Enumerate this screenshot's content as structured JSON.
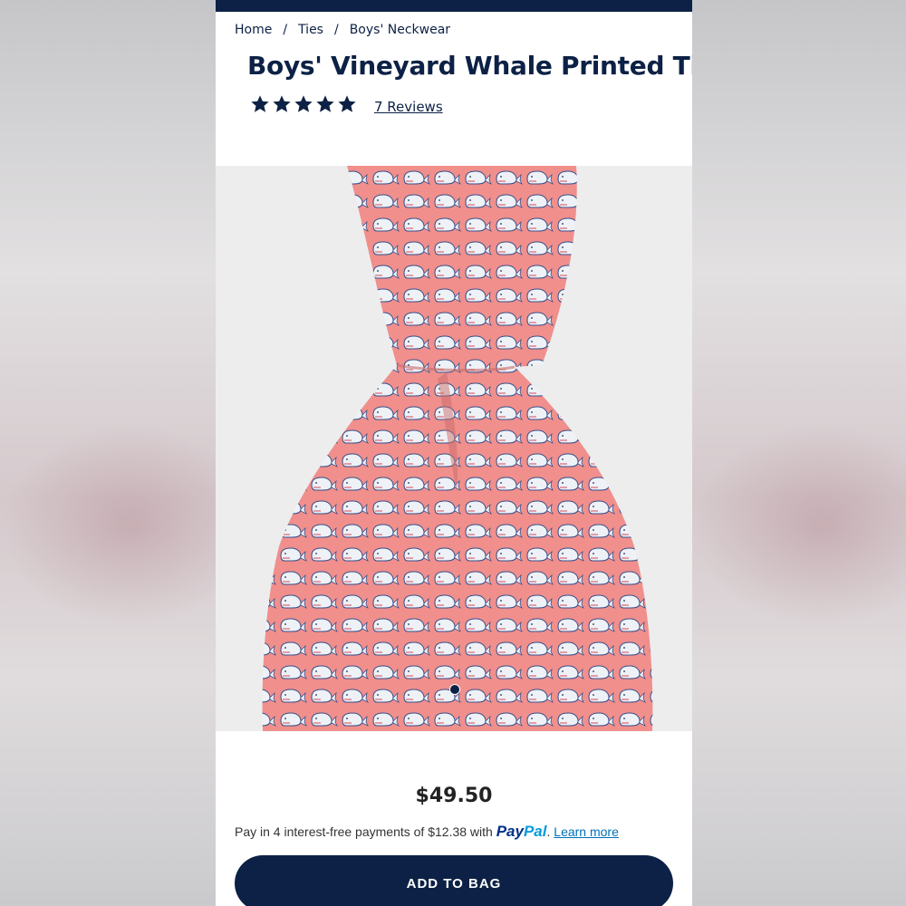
{
  "breadcrumb": {
    "items": [
      "Home",
      "Ties",
      "Boys' Neckwear"
    ],
    "separator": "/"
  },
  "product": {
    "title": "Boys' Vineyard Whale Printed Tie",
    "rating": {
      "stars": 5,
      "max": 5,
      "reviews_label": "7 Reviews"
    },
    "image": {
      "icon": "whale-print-tie-image"
    },
    "gallery": {
      "current": 1
    },
    "price": "$49.50",
    "paypal": {
      "prefix": "Pay in 4 interest-free payments of $12.38 with",
      "logo_pay": "Pay",
      "logo_pal": "Pal",
      "suffix": ".",
      "learn_more": "Learn more"
    },
    "add_to_bag_label": "ADD TO BAG"
  },
  "colors": {
    "navy": "#0c2145",
    "tie_pink": "#f08f8c",
    "paypal_blue": "#003087",
    "paypal_light": "#009cde"
  }
}
